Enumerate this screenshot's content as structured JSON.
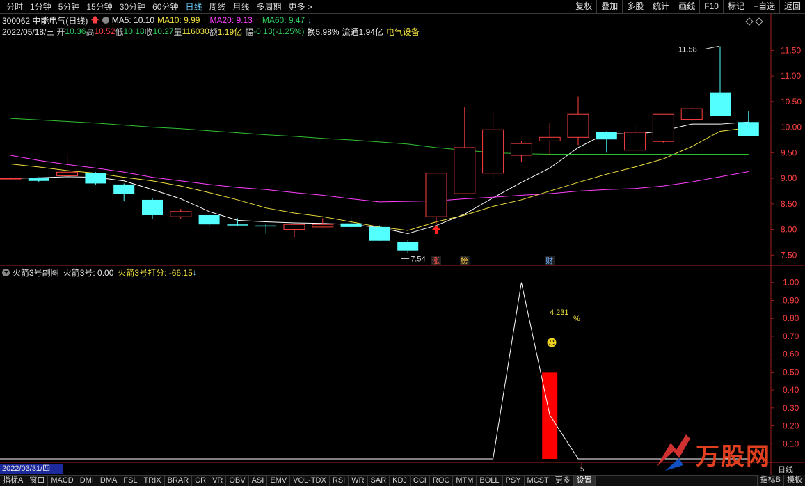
{
  "toolbar": {
    "periods": [
      "分时",
      "1分钟",
      "5分钟",
      "15分钟",
      "30分钟",
      "60分钟",
      "日线",
      "周线",
      "月线",
      "多周期",
      "更多 >"
    ],
    "active_period": "日线",
    "right_buttons": [
      "复权",
      "叠加",
      "多股",
      "统计",
      "画线",
      "F10",
      "标记",
      "+自选",
      "返回"
    ]
  },
  "header": {
    "code_name": "300062 中能电气(日线)",
    "ma5": "MA5: 10.10",
    "ma10": "MA10: 9.99",
    "ma20": "MA20: 9.13",
    "ma60": "MA60: 9.47",
    "date": "2022/05/18/三",
    "open_label": "开",
    "open": "10.36",
    "high_label": "高",
    "high": "10.52",
    "low_label": "低",
    "low": "10.18",
    "close_label": "收",
    "close": "10.27",
    "vol_label": "量",
    "vol": "116030",
    "amt_label": "额",
    "amt": "1.19亿",
    "chg_label": "幅",
    "chg": "-0.13(-1.25%)",
    "turnover": "换5.98%",
    "float": "流通1.94亿",
    "sector": "电气设备"
  },
  "chart_data": [
    {
      "type": "candlestick",
      "title": "300062 中能电气(日线)",
      "y_ticks": [
        7.5,
        8.0,
        8.5,
        9.0,
        9.5,
        10.0,
        10.5,
        11.0,
        11.5
      ],
      "ylim": [
        7.3,
        11.75
      ],
      "candles": [
        {
          "o": 9.0,
          "h": 9.02,
          "l": 8.98,
          "c": 9.0
        },
        {
          "o": 9.0,
          "h": 9.02,
          "l": 8.93,
          "c": 8.95
        },
        {
          "o": 9.05,
          "h": 9.48,
          "l": 9.0,
          "c": 9.12
        },
        {
          "o": 9.1,
          "h": 9.12,
          "l": 8.88,
          "c": 8.9
        },
        {
          "o": 8.88,
          "h": 8.9,
          "l": 8.55,
          "c": 8.7
        },
        {
          "o": 8.58,
          "h": 8.62,
          "l": 8.2,
          "c": 8.28
        },
        {
          "o": 8.25,
          "h": 8.4,
          "l": 8.2,
          "c": 8.35
        },
        {
          "o": 8.28,
          "h": 8.3,
          "l": 8.05,
          "c": 8.1
        },
        {
          "o": 8.1,
          "h": 8.22,
          "l": 8.07,
          "c": 8.08
        },
        {
          "o": 8.08,
          "h": 8.12,
          "l": 7.92,
          "c": 8.06
        },
        {
          "o": 8.0,
          "h": 8.12,
          "l": 7.84,
          "c": 8.1
        },
        {
          "o": 8.05,
          "h": 8.22,
          "l": 8.04,
          "c": 8.1
        },
        {
          "o": 8.12,
          "h": 8.25,
          "l": 8.02,
          "c": 8.05
        },
        {
          "o": 8.05,
          "h": 8.08,
          "l": 7.78,
          "c": 7.78
        },
        {
          "o": 7.75,
          "h": 7.79,
          "l": 7.54,
          "c": 7.59
        },
        {
          "o": 8.25,
          "h": 9.1,
          "l": 8.12,
          "c": 9.1
        },
        {
          "o": 8.7,
          "h": 10.4,
          "l": 8.7,
          "c": 9.6
        },
        {
          "o": 9.1,
          "h": 10.3,
          "l": 9.0,
          "c": 9.95
        },
        {
          "o": 9.45,
          "h": 9.72,
          "l": 9.32,
          "c": 9.68
        },
        {
          "o": 9.73,
          "h": 10.08,
          "l": 9.45,
          "c": 9.8
        },
        {
          "o": 9.8,
          "h": 10.6,
          "l": 9.65,
          "c": 10.25
        },
        {
          "o": 9.9,
          "h": 9.92,
          "l": 9.5,
          "c": 9.76
        },
        {
          "o": 9.55,
          "h": 10.05,
          "l": 9.53,
          "c": 9.9
        },
        {
          "o": 9.72,
          "h": 10.25,
          "l": 9.7,
          "c": 10.25
        },
        {
          "o": 10.15,
          "h": 10.38,
          "l": 10.12,
          "c": 10.36
        },
        {
          "o": 10.68,
          "h": 11.58,
          "l": 10.22,
          "c": 10.22
        },
        {
          "o": 10.1,
          "h": 10.32,
          "l": 9.83,
          "c": 9.83
        }
      ],
      "ma_lines": [
        {
          "name": "MA5",
          "color": "#ffffff",
          "values": [
            9.0,
            9.01,
            9.03,
            9.02,
            8.95,
            8.78,
            8.6,
            8.35,
            8.18,
            8.15,
            8.13,
            8.12,
            8.1,
            8.04,
            7.92,
            8.08,
            8.3,
            8.62,
            8.92,
            9.2,
            9.6,
            9.88,
            9.86,
            9.93,
            10.06,
            10.06,
            10.1
          ]
        },
        {
          "name": "MA10",
          "color": "#f0e040",
          "values": [
            9.28,
            9.22,
            9.15,
            9.1,
            9.02,
            8.95,
            8.85,
            8.72,
            8.58,
            8.42,
            8.32,
            8.25,
            8.15,
            8.05,
            7.98,
            8.15,
            8.28,
            8.45,
            8.58,
            8.75,
            8.92,
            9.08,
            9.22,
            9.38,
            9.62,
            9.92,
            9.99
          ]
        },
        {
          "name": "MA20",
          "color": "#ff40ff",
          "values": [
            9.45,
            9.35,
            9.27,
            9.2,
            9.12,
            9.02,
            8.95,
            8.88,
            8.82,
            8.78,
            8.72,
            8.67,
            8.6,
            8.54,
            8.55,
            8.56,
            8.6,
            8.63,
            8.67,
            8.7,
            8.75,
            8.78,
            8.8,
            8.85,
            8.93,
            9.03,
            9.13
          ]
        },
        {
          "name": "MA60",
          "color": "#30c030",
          "values": [
            10.17,
            10.14,
            10.11,
            10.08,
            10.04,
            10.0,
            9.97,
            9.93,
            9.89,
            9.85,
            9.82,
            9.78,
            9.75,
            9.71,
            9.67,
            9.6,
            9.55,
            9.5,
            9.48,
            9.47,
            9.47,
            9.47,
            9.47,
            9.47,
            9.47,
            9.47,
            9.47
          ]
        }
      ],
      "annotations": [
        {
          "text": "11.58",
          "candle": 25,
          "price": 11.58
        },
        {
          "text": "7.54",
          "candle": 14,
          "price": 7.54
        }
      ],
      "marker_labels": [
        {
          "text": "涨",
          "candle": 15,
          "color": "#ff5050"
        },
        {
          "text": "榜",
          "candle": 16,
          "color": "#f0c040"
        },
        {
          "text": "财",
          "candle": 19,
          "color": "#6fb0ff"
        }
      ]
    },
    {
      "type": "line",
      "title": "火箭3号副图",
      "y_ticks": [
        0.1,
        0.2,
        0.3,
        0.4,
        0.5,
        0.6,
        0.7,
        0.8,
        0.9,
        1.0
      ],
      "ylim": [
        0.0,
        1.03
      ],
      "line": [
        0,
        0,
        0,
        0,
        0,
        0,
        0,
        0,
        0,
        0,
        0,
        0,
        0,
        0,
        0,
        0,
        0,
        0,
        1.0,
        0.26,
        0,
        0,
        0,
        0,
        0,
        0,
        0
      ],
      "bar": {
        "candle": 19,
        "value": 0.5
      },
      "annotations": [
        {
          "text": "4.231",
          "unit": "%"
        }
      ]
    }
  ],
  "subchart": {
    "title": "火箭3号副图",
    "rocket3": "火箭3号: 0.00",
    "rocket3_score": "火箭3号打分: -66.15"
  },
  "footer": {
    "date": "2022/03/31/四",
    "right_label": "日线",
    "tick_5": "5",
    "indicator_tabs": [
      "指标A",
      "窗口",
      "MACD",
      "DMI",
      "DMA",
      "FSL",
      "TRIX",
      "BRAR",
      "CR",
      "VR",
      "OBV",
      "ASI",
      "EMV",
      "VOL-TDX",
      "RSI",
      "WR",
      "SAR",
      "KDJ",
      "CCI",
      "ROC",
      "MTM",
      "BOLL",
      "PSY",
      "MCST",
      "更多",
      "设置"
    ],
    "active_tab": "设置",
    "right_tabs": [
      "指标B",
      "模板"
    ]
  },
  "watermark": {
    "text": "万股网",
    "url": "www.201882.com"
  },
  "colors": {
    "up": "#ff4040",
    "down": "#54ffff",
    "axis": "#a02020",
    "ma60": "#30c030"
  }
}
